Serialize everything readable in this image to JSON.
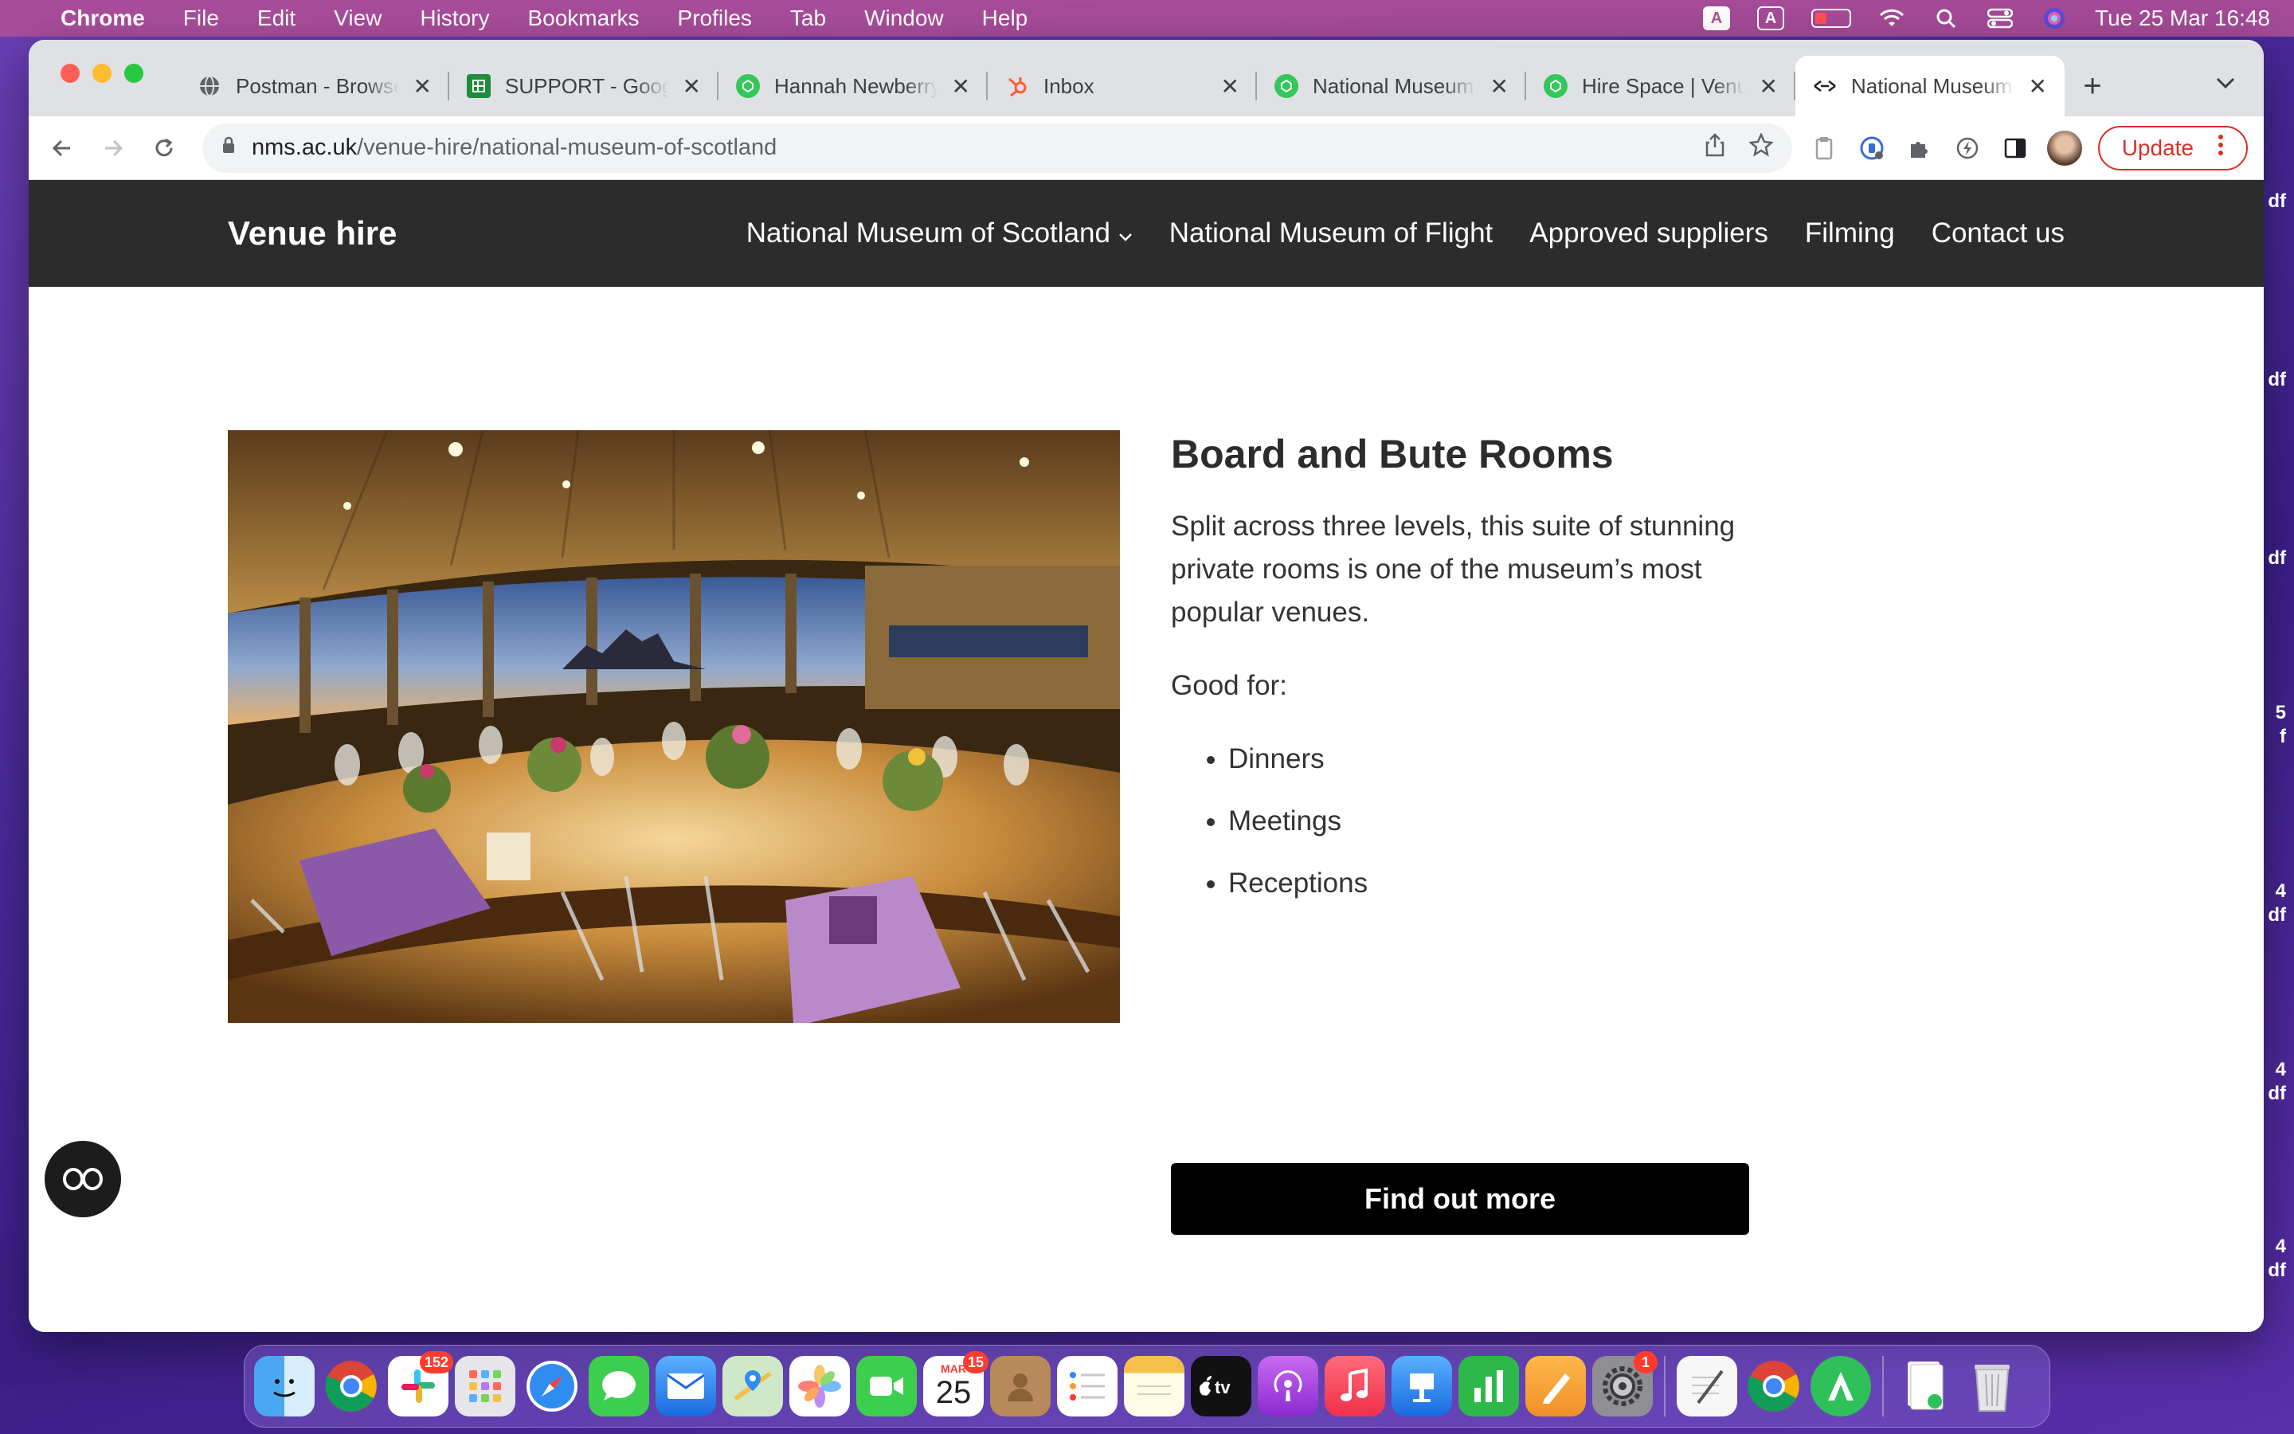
{
  "menubar": {
    "app_name": "Chrome",
    "menus": [
      "File",
      "Edit",
      "View",
      "History",
      "Bookmarks",
      "Profiles",
      "Tab",
      "Window",
      "Help"
    ],
    "status_icons": [
      "A",
      "A"
    ],
    "datetime": "Tue 25 Mar  16:48"
  },
  "browser": {
    "tabs": [
      {
        "title": "Postman - Browse",
        "icon": "globe-icon",
        "color": "#5f6368"
      },
      {
        "title": "SUPPORT - Googl",
        "icon": "sheets-icon",
        "color": "#1e8e3e"
      },
      {
        "title": "Hannah Newberry",
        "icon": "hirespace-icon",
        "color": "#34c759"
      },
      {
        "title": "Inbox",
        "icon": "hubspot-icon",
        "color": "#ff5c35"
      },
      {
        "title": "National Museum",
        "icon": "hirespace-icon",
        "color": "#34c759"
      },
      {
        "title": "Hire Space | Venu",
        "icon": "hirespace-icon",
        "color": "#34c759"
      },
      {
        "title": "National Museum",
        "icon": "nms-icon",
        "color": "#202124",
        "active": true
      }
    ],
    "url_host": "nms.ac.uk",
    "url_path": "/venue-hire/national-museum-of-scotland",
    "update_label": "Update"
  },
  "site": {
    "brand": "Venue hire",
    "nav": [
      "National Museum of Scotland",
      "National Museum of Flight",
      "Approved suppliers",
      "Filming",
      "Contact us"
    ]
  },
  "venue": {
    "title": "Board and Bute Rooms",
    "description": "Split across three levels, this suite of stunning private rooms is one of the museum’s most popular venues.",
    "good_for_label": "Good for:",
    "good_for": [
      "Dinners",
      "Meetings",
      "Receptions"
    ],
    "cta_label": "Find out more"
  },
  "desktop_fragments": [
    "df",
    "df",
    "df",
    "5\nf",
    "4\ndf",
    "4\ndf",
    "4\ndf"
  ],
  "dock": {
    "calendar_month": "MAR",
    "calendar_day": "25",
    "slack_badge": "152",
    "calendar_badge": "15",
    "settings_badge": "1"
  }
}
